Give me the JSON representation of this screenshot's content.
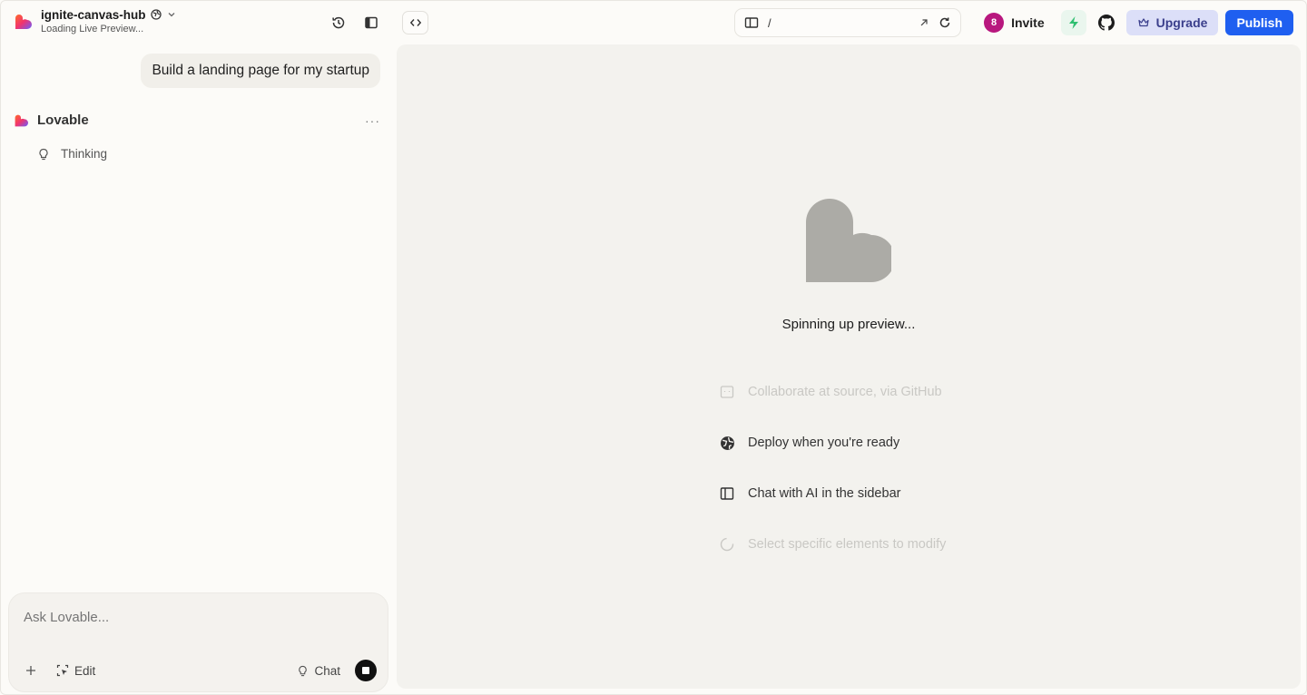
{
  "project": {
    "name": "ignite-canvas-hub",
    "status": "Loading Live Preview..."
  },
  "header": {
    "url_path": "/",
    "avatar_initial": "8",
    "invite_label": "Invite",
    "upgrade_label": "Upgrade",
    "publish_label": "Publish"
  },
  "chat": {
    "user_message": "Build a landing page for my startup",
    "assistant_name": "Lovable",
    "more_label": "···",
    "thinking_label": "Thinking"
  },
  "composer": {
    "placeholder": "Ask Lovable...",
    "edit_label": "Edit",
    "chat_label": "Chat"
  },
  "preview": {
    "loading_text": "Spinning up preview...",
    "features": [
      {
        "label": "Collaborate at source, via GitHub",
        "icon": "github-box-icon",
        "faded": true
      },
      {
        "label": "Deploy when you're ready",
        "icon": "globe-icon",
        "faded": false
      },
      {
        "label": "Chat with AI in the sidebar",
        "icon": "sidebar-icon",
        "faded": false
      },
      {
        "label": "Select specific elements to modify",
        "icon": "select-circle-icon",
        "faded": true
      }
    ]
  },
  "colors": {
    "publish": "#1f5ff0",
    "upgrade_bg": "#dcdff8",
    "avatar": "#b8177e",
    "heart": "#acaba6",
    "bolt": "#2fbf71"
  }
}
